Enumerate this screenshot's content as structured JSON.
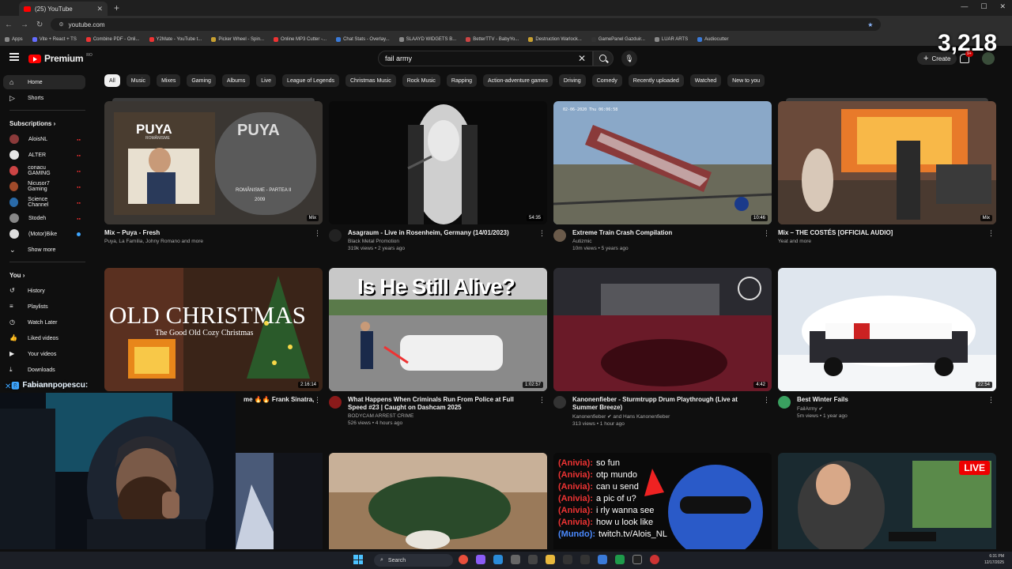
{
  "browser": {
    "tab_title": "(25) YouTube",
    "url": "youtube.com",
    "bookmarks": [
      "Apps",
      "Vite + React + TS",
      "Combine PDF - Onli...",
      "Y2Mate - YouTube t...",
      "Picker Wheel - Spin...",
      "Online MP3 Cutter -...",
      "Chat Stats - Overlay...",
      "SLAAYD WIDGETS B...",
      "BetterTTV - BabyYo...",
      "Destruction Warlock...",
      "GamePanel Gazduir...",
      "LUAR ARTS",
      "Audiocutter"
    ]
  },
  "header": {
    "logo_text": "Premium",
    "logo_sup": "RO",
    "search_value": "fail army",
    "create_label": "Create",
    "notif_count": "9+"
  },
  "overlay": {
    "viewer_counter": "3,218",
    "chat_user": "Fabiannpopescu:"
  },
  "chips": [
    "All",
    "Music",
    "Mixes",
    "Gaming",
    "Albums",
    "Live",
    "League of Legends",
    "Christmas Music",
    "Rock Music",
    "Rapping",
    "Action-adventure games",
    "Driving",
    "Comedy",
    "Recently uploaded",
    "Watched",
    "New to you"
  ],
  "sidebar": {
    "home": "Home",
    "shorts": "Shorts",
    "subscriptions_label": "Subscriptions",
    "subs": [
      {
        "name": "AloisNL",
        "color": "#8b3a3a"
      },
      {
        "name": "ALTER",
        "color": "#e8e8e8"
      },
      {
        "name": "conacu GAMING",
        "color": "#c44"
      },
      {
        "name": "Nicusor7 Gaming",
        "color": "#a04a2a"
      },
      {
        "name": "Science Channel",
        "color": "#2a6aa8"
      },
      {
        "name": "Stodeh",
        "color": "#888"
      },
      {
        "name": "(Motor)Bike",
        "color": "#ddd"
      }
    ],
    "show_more": "Show more",
    "you_label": "You",
    "you_items": [
      "History",
      "Playlists",
      "Watch Later",
      "Liked videos",
      "Your videos",
      "Downloads"
    ],
    "show_more_2": "Show more"
  },
  "videos": [
    {
      "title": "Mix – Puya - Fresh",
      "line1": "Puya, La Familia, Johny Romano and more",
      "line2": "",
      "duration": "Mix",
      "channel_color": ""
    },
    {
      "title": "Asagraum - Live in Rosenheim, Germany (14/01/2023)",
      "line1": "Black Metal Promotion",
      "line2": "319k views • 2 years ago",
      "duration": "54:35",
      "channel_color": "#222"
    },
    {
      "title": "Extreme Train Crash Compilation",
      "line1": "Autizmic",
      "line2": "10m views • 5 years ago",
      "duration": "10:46",
      "channel_color": "#6a5a4a"
    },
    {
      "title": "Mix – THE COSTÉS [OFFICIAL AUDIO]",
      "line1": "Yeat and more",
      "line2": "",
      "duration": "Mix",
      "channel_color": ""
    },
    {
      "title": "me 🔥🔥 Frank Sinatra,",
      "line1": "",
      "line2": "",
      "duration": "2:16:14",
      "channel_color": ""
    },
    {
      "title": "What Happens When Criminals Run From Police at Full Speed #23 | Caught on Dashcam 2025",
      "line1": "BODYCAM ARREST CRIME",
      "line2": "526 views • 4 hours ago",
      "duration": "1:02:57",
      "channel_color": "#8a1a1a"
    },
    {
      "title": "Kanonenfieber - Sturmtrupp Drum Playthrough (Live at Summer Breeze)",
      "line1": "Kanonenfieber ✔ and Hans Kanonenfieber",
      "line2": "313 views • 1 hour ago",
      "duration": "4:42",
      "channel_color": "#333"
    },
    {
      "title": "Best Winter Fails",
      "line1": "FailArmy ✔",
      "line2": "5m views • 1 year ago",
      "duration": "22:54",
      "channel_color": "#3aa060"
    }
  ],
  "thumb_text": {
    "puya_a": "PUYA",
    "puya_sub": "ROMÂNISME",
    "puya_b": "PUYA",
    "puya_b_sub": "ROMÂNISME - PARTEA II",
    "puya_b_year": "2009",
    "xmas_title": "OLD CHRISTMAS",
    "xmas_sub": "The Good Old Cozy Christmas",
    "alive": "Is He Still Alive?",
    "train_date": "02-06-2020 Thu 06:06:58",
    "live_badge": "LIVE",
    "chat_lines": [
      {
        "user": "(Anivia):",
        "msg": "so fun"
      },
      {
        "user": "(Anivia):",
        "msg": "otp mundo"
      },
      {
        "user": "(Anivia):",
        "msg": "can u send"
      },
      {
        "user": "(Anivia):",
        "msg": "a pic of u?"
      },
      {
        "user": "(Anivia):",
        "msg": "i rly wanna see"
      },
      {
        "user": "(Anivia):",
        "msg": "how u look like"
      },
      {
        "user": "(Mundo):",
        "msg": "twitch.tv/Alois_NL"
      }
    ]
  },
  "taskbar": {
    "search": "Search",
    "time": "6:31 PM",
    "date": "12/17/2025"
  }
}
